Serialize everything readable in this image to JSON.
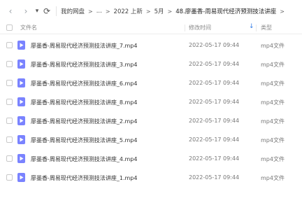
{
  "nav": {
    "back_icon": "chevron-left-icon",
    "forward_icon": "chevron-right-icon",
    "history_icon": "caret-down-icon",
    "refresh_icon": "refresh-icon",
    "back_glyph": "‹",
    "forward_glyph": "›",
    "history_glyph": "▾",
    "refresh_glyph": "⟳"
  },
  "breadcrumb": {
    "items": [
      "我的网盘",
      "...",
      "2022 上新",
      "5月",
      "48.廖墨香-周易现代经济预测技法讲座"
    ],
    "separator": ">",
    "trailing_separator": ">"
  },
  "header": {
    "name": "文件名",
    "date": "修改时间",
    "sort_icon": "sort-arrow-down-icon",
    "sort_glyph": "↓",
    "type": "类型"
  },
  "files": [
    {
      "name": "廖墨香-周易现代经济预测技法讲座_7.mp4",
      "date": "2022-05-17 09:44",
      "type": "mp4文件"
    },
    {
      "name": "廖墨香-周易现代经济预测技法讲座_3.mp4",
      "date": "2022-05-17 09:44",
      "type": "mp4文件"
    },
    {
      "name": "廖墨香-周易现代经济预测技法讲座_6.mp4",
      "date": "2022-05-17 09:44",
      "type": "mp4文件"
    },
    {
      "name": "廖墨香-周易现代经济预测技法讲座_8.mp4",
      "date": "2022-05-17 09:44",
      "type": "mp4文件"
    },
    {
      "name": "廖墨香-周易现代经济预测技法讲座_2.mp4",
      "date": "2022-05-17 09:44",
      "type": "mp4文件"
    },
    {
      "name": "廖墨香-周易现代经济预测技法讲座_5.mp4",
      "date": "2022-05-17 09:44",
      "type": "mp4文件"
    },
    {
      "name": "廖墨香-周易现代经济预测技法讲座_4.mp4",
      "date": "2022-05-17 09:44",
      "type": "mp4文件"
    },
    {
      "name": "廖墨香-周易现代经济预测技法讲座_1.mp4",
      "date": "2022-05-17 09:44",
      "type": "mp4文件"
    }
  ],
  "colors": {
    "accent": "#2f7ae5",
    "video_icon": "#7a83ff"
  }
}
